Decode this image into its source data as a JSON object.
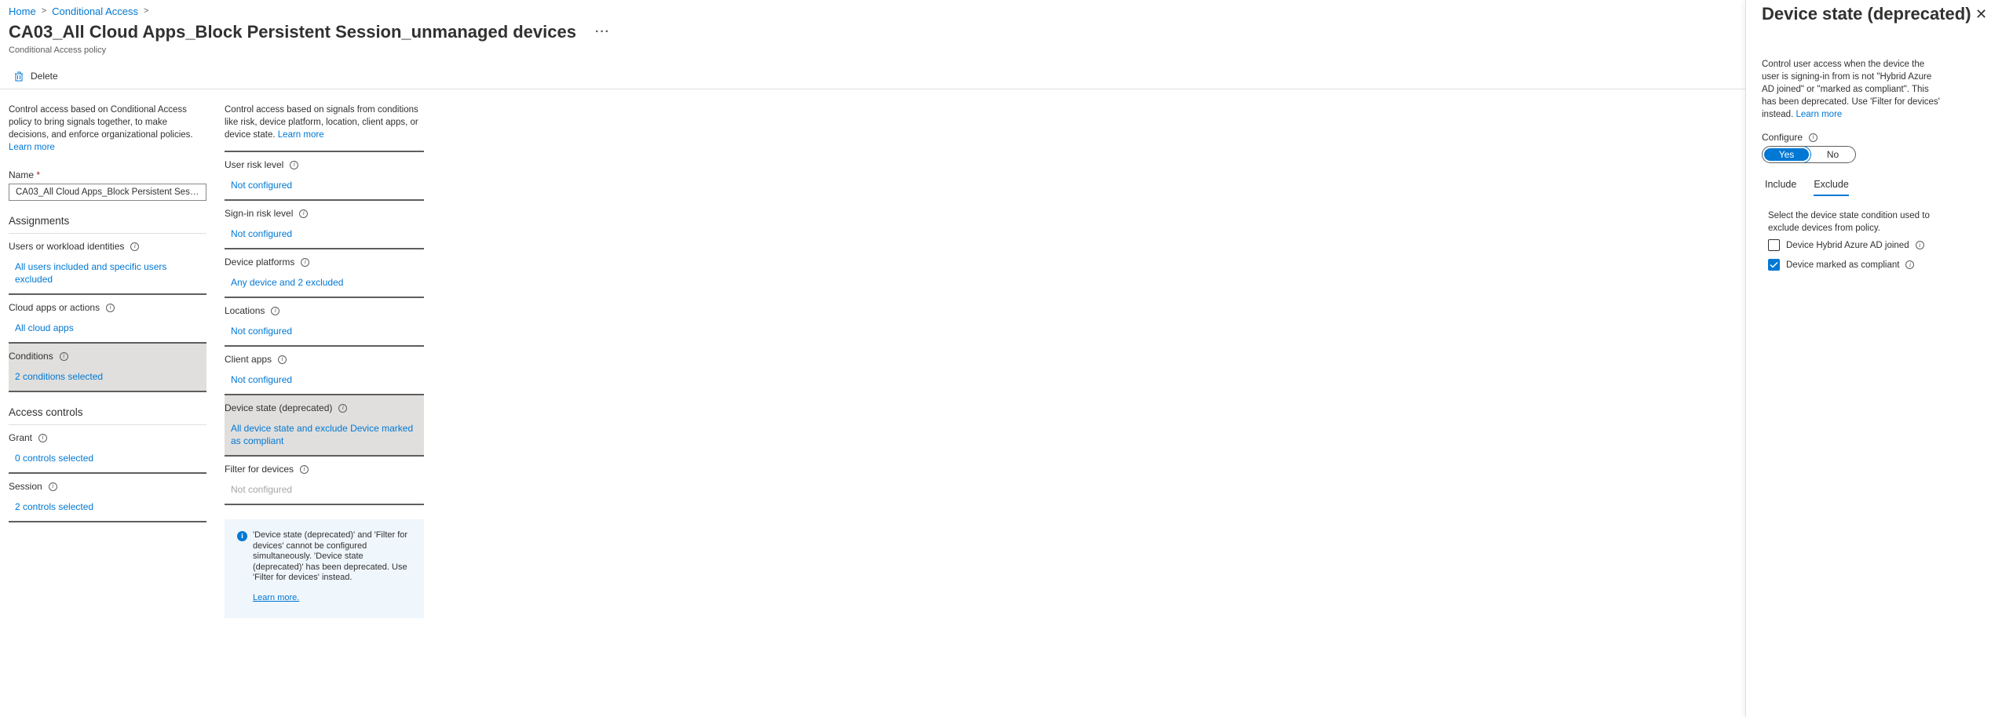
{
  "breadcrumb": [
    {
      "label": "Home"
    },
    {
      "label": "Conditional Access"
    }
  ],
  "page": {
    "title": "CA03_All Cloud Apps_Block Persistent Session_unmanaged devices",
    "more": "···",
    "subtitle": "Conditional Access policy"
  },
  "toolbar": {
    "delete_label": "Delete"
  },
  "col1": {
    "intro": "Control access based on Conditional Access policy to bring signals together, to make decisions, and enforce organizational policies.",
    "learn_more": "Learn more",
    "name_label": "Name",
    "name_required": "*",
    "name_value": "CA03_All Cloud Apps_Block Persistent Sessi...",
    "assignments_heading": "Assignments",
    "assignments": [
      {
        "label": "Users or workload identities",
        "value": "All users included and specific users excluded"
      },
      {
        "label": "Cloud apps or actions",
        "value": "All cloud apps"
      },
      {
        "label": "Conditions",
        "value": "2 conditions selected"
      }
    ],
    "access_heading": "Access controls",
    "access": [
      {
        "label": "Grant",
        "value": "0 controls selected"
      },
      {
        "label": "Session",
        "value": "2 controls selected"
      }
    ]
  },
  "col2": {
    "intro": "Control access based on signals from conditions like risk, device platform, location, client apps, or device state.",
    "learn_more": "Learn more",
    "conditions": [
      {
        "label": "User risk level",
        "value": "Not configured"
      },
      {
        "label": "Sign-in risk level",
        "value": "Not configured"
      },
      {
        "label": "Device platforms",
        "value": "Any device and 2 excluded"
      },
      {
        "label": "Locations",
        "value": "Not configured"
      },
      {
        "label": "Client apps",
        "value": "Not configured"
      },
      {
        "label": "Device state (deprecated)",
        "value": "All device state and exclude Device marked as compliant"
      },
      {
        "label": "Filter for devices",
        "value": "Not configured"
      }
    ],
    "info_text": "'Device state (deprecated)' and 'Filter for devices' cannot be configured simultaneously. 'Device state (deprecated)' has been deprecated. Use 'Filter for devices' instead.",
    "info_learn": "Learn more."
  },
  "panel": {
    "title": "Device state (deprecated)",
    "close": "✕",
    "desc": "Control user access when the device the user is signing-in from is not \"Hybrid Azure AD joined\" or \"marked as compliant\". This has been deprecated. Use 'Filter for devices' instead.",
    "desc_learn": "Learn more",
    "configure_label": "Configure",
    "toggle_yes": "Yes",
    "toggle_no": "No",
    "tab_include": "Include",
    "tab_exclude": "Exclude",
    "exclude_desc": "Select the device state condition used to exclude devices from policy.",
    "checks": [
      {
        "label": "Device Hybrid Azure AD joined",
        "checked": false
      },
      {
        "label": "Device marked as compliant",
        "checked": true
      }
    ]
  },
  "colors": {
    "accent": "#0078d4",
    "selected_bg": "#e1dfdd",
    "info_bg": "#eff6fc"
  }
}
